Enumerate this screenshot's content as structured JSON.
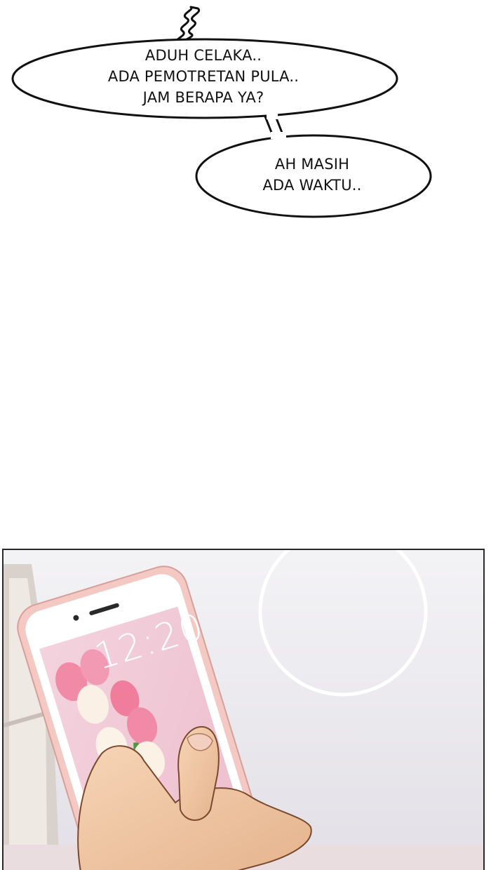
{
  "speech": {
    "bubble1": {
      "lines": [
        "ADUH CELAKA..",
        "ADA PEMOTRETAN PULA..",
        "JAM BERAPA YA?"
      ]
    },
    "bubble2": {
      "lines": [
        "AH MASIH",
        "ADA WAKTU.."
      ]
    }
  },
  "panel": {
    "phone": {
      "lock_screen_time": "12:20",
      "case_color": "#f4c9c4",
      "screen_color": "#f1c9d6"
    }
  }
}
